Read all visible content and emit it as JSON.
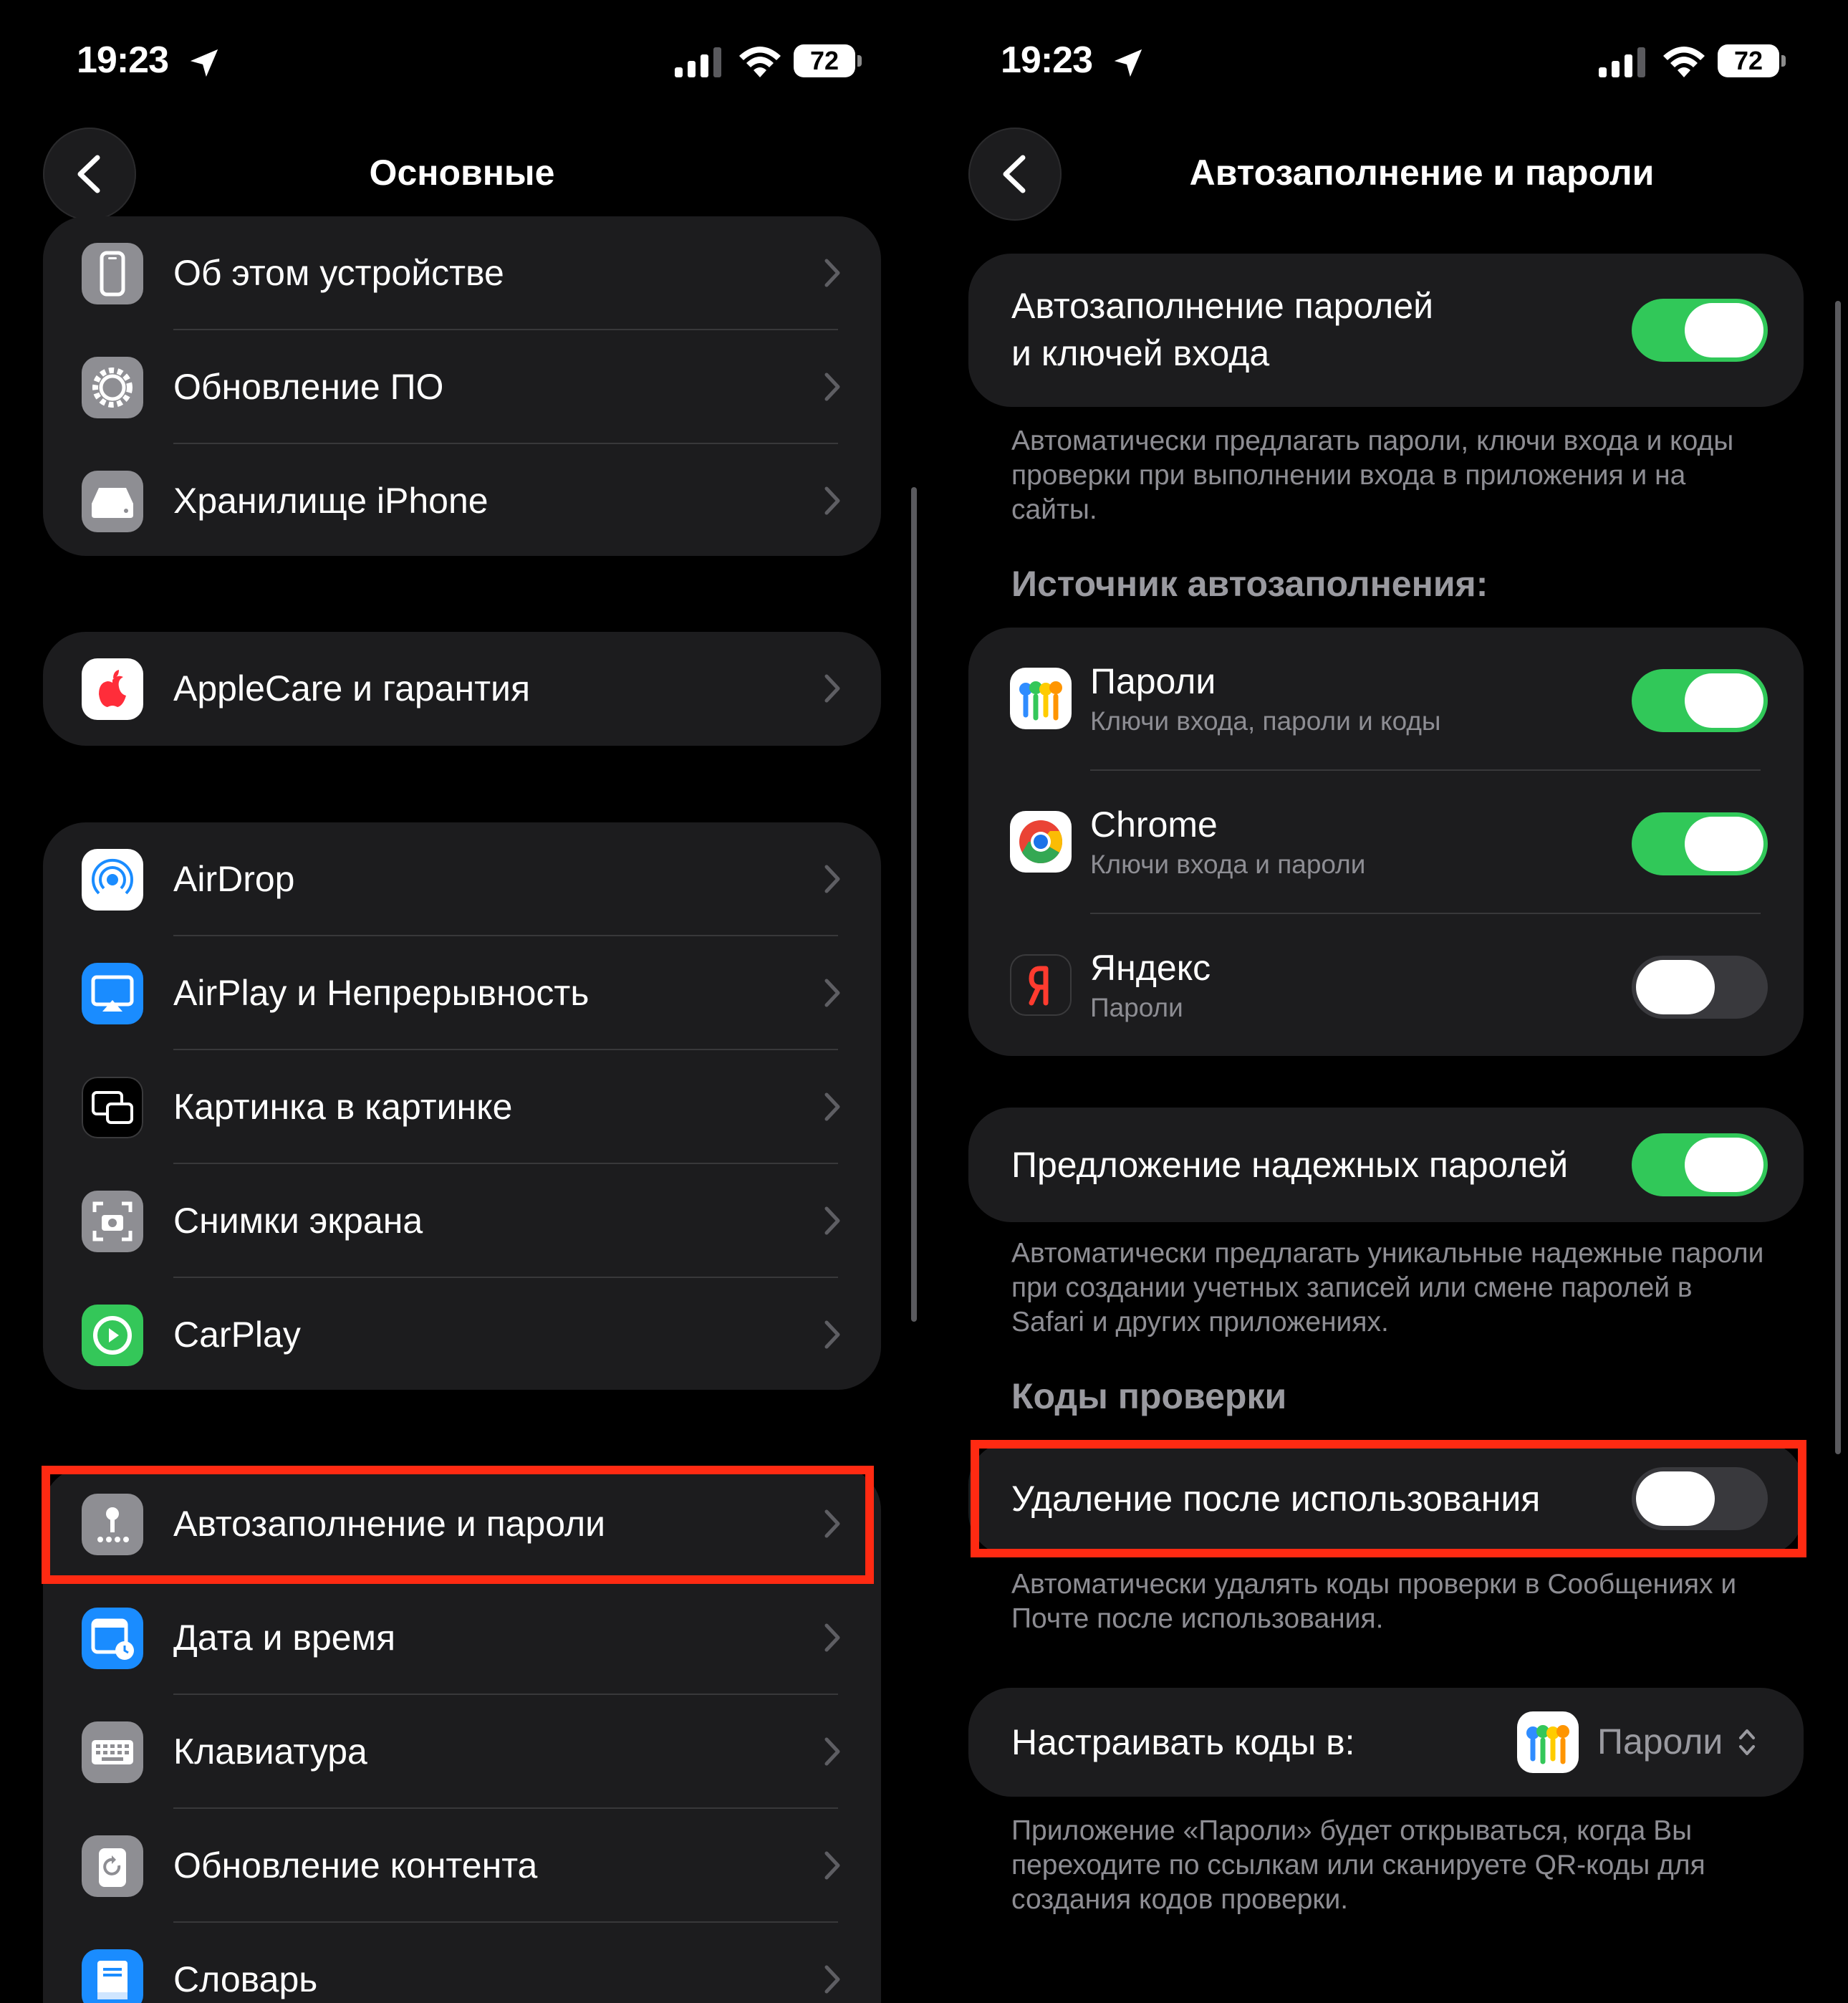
{
  "status_bar": {
    "time": "19:23",
    "battery": "72"
  },
  "left": {
    "title": "Основные",
    "groups": [
      [
        {
          "label": "Об этом устройстве",
          "icon": "phone-icon"
        },
        {
          "label": "Обновление ПО",
          "icon": "gear-icon"
        },
        {
          "label": "Хранилище iPhone",
          "icon": "storage-icon"
        }
      ],
      [
        {
          "label": "AppleCare и гарантия",
          "icon": "apple-icon"
        }
      ],
      [
        {
          "label": "AirDrop",
          "icon": "airdrop-icon"
        },
        {
          "label": "AirPlay и Непрерывность",
          "icon": "airplay-icon"
        },
        {
          "label": "Картинка в картинке",
          "icon": "pip-icon"
        },
        {
          "label": "Снимки экрана",
          "icon": "screenshot-icon"
        },
        {
          "label": "CarPlay",
          "icon": "carplay-icon"
        }
      ],
      [
        {
          "label": "Автозаполнение и пароли",
          "icon": "key-icon"
        },
        {
          "label": "Дата и время",
          "icon": "calendar-clock-icon"
        },
        {
          "label": "Клавиатура",
          "icon": "keyboard-icon"
        },
        {
          "label": "Обновление контента",
          "icon": "refresh-icon"
        },
        {
          "label": "Словарь",
          "icon": "dictionary-icon"
        }
      ]
    ]
  },
  "right": {
    "title": "Автозаполнение и пароли",
    "autofill": {
      "label_line1": "Автозаполнение паролей",
      "label_line2": "и ключей входа",
      "enabled": true,
      "footnote": "Автоматически предлагать пароли, ключи входа и коды проверки при выполнении входа в приложения и на сайты."
    },
    "sources_header": "Источник автозаполнения:",
    "sources": [
      {
        "name": "Пароли",
        "subtitle": "Ключи входа, пароли и коды",
        "enabled": true,
        "icon": "passwords-app-icon"
      },
      {
        "name": "Chrome",
        "subtitle": "Ключи входа и пароли",
        "enabled": true,
        "icon": "chrome-icon"
      },
      {
        "name": "Яндекс",
        "subtitle": "Пароли",
        "enabled": false,
        "icon": "yandex-icon"
      }
    ],
    "strong_passwords": {
      "label": "Предложение надежных паролей",
      "enabled": true,
      "footnote": "Автоматически предлагать уникальные надежные пароли при создании учетных записей или смене паролей в Safari и других приложениях."
    },
    "codes_header": "Коды проверки",
    "delete_after_use": {
      "label": "Удаление после использования",
      "enabled": false,
      "footnote": "Автоматически удалять коды проверки в Сообщениях и Почте после использования."
    },
    "setup_codes": {
      "label": "Настраивать коды в:",
      "value": "Пароли",
      "footnote": "Приложение «Пароли» будет открываться, когда Вы переходите по ссылкам или сканируете QR-коды для создания кодов проверки."
    }
  },
  "colors": {
    "toggle_on": "#31c859",
    "highlight": "#ff2a12",
    "card": "#1c1c1e"
  }
}
